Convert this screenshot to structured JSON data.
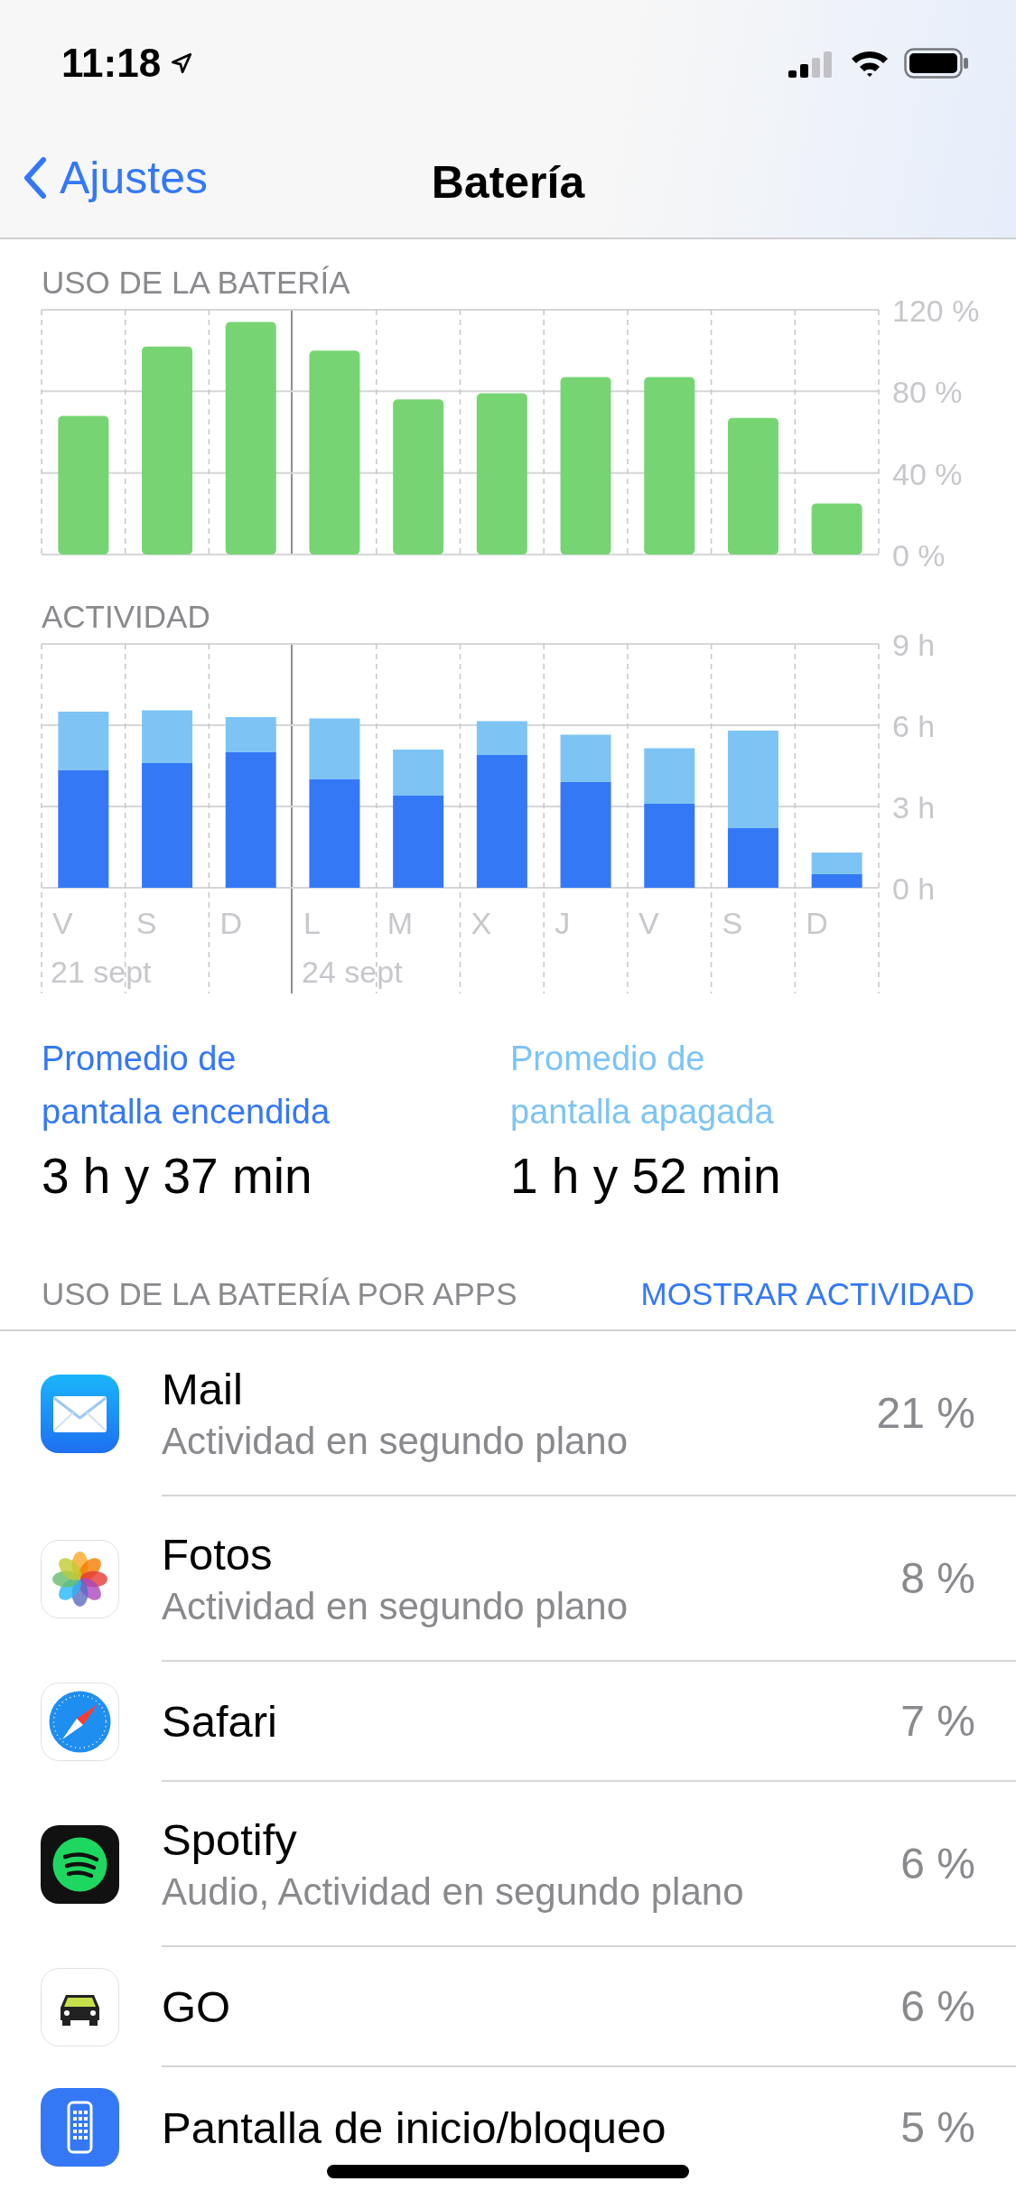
{
  "status_bar": {
    "time": "11:18"
  },
  "nav": {
    "back": "Ajustes",
    "title": "Batería"
  },
  "battery_usage": {
    "title": "USO DE LA BATERÍA",
    "chart_data": {
      "type": "bar",
      "ylim": [
        0,
        120
      ],
      "yticks": [
        {
          "value": 0,
          "label": "0 %"
        },
        {
          "value": 40,
          "label": "40 %"
        },
        {
          "value": 80,
          "label": "80 %"
        },
        {
          "value": 120,
          "label": "120 %"
        }
      ],
      "values": [
        68,
        102,
        114,
        100,
        76,
        79,
        87,
        87,
        67,
        25
      ]
    }
  },
  "activity": {
    "title": "ACTIVIDAD",
    "week_labels": [
      "21 sept",
      "24 sept"
    ],
    "chart_data": {
      "type": "bar",
      "stacked": true,
      "categories": [
        "V",
        "S",
        "D",
        "L",
        "M",
        "X",
        "J",
        "V",
        "S",
        "D"
      ],
      "ylim": [
        0,
        9
      ],
      "yticks": [
        {
          "value": 0,
          "label": "0 h"
        },
        {
          "value": 3,
          "label": "3 h"
        },
        {
          "value": 6,
          "label": "6 h"
        },
        {
          "value": 9,
          "label": "9 h"
        }
      ],
      "series": [
        {
          "color": "#3478f6",
          "values": [
            4.35,
            4.6,
            5.0,
            4.0,
            3.4,
            4.9,
            3.9,
            3.1,
            2.2,
            0.5
          ]
        },
        {
          "color": "#7dc4f5",
          "values": [
            2.15,
            1.95,
            1.3,
            2.25,
            1.7,
            1.25,
            1.75,
            2.05,
            3.6,
            0.8
          ]
        }
      ]
    }
  },
  "averages": [
    {
      "label": [
        "Promedio de",
        "pantalla encendida"
      ],
      "value": "3 h y 37 min",
      "color": "#3478f6"
    },
    {
      "label": [
        "Promedio de",
        "pantalla apagada"
      ],
      "value": "1 h y 52 min",
      "color": "#7dc4f5"
    }
  ],
  "apps_section": {
    "title": "USO DE LA BATERÍA POR APPS",
    "action": "MOSTRAR ACTIVIDAD"
  },
  "apps": [
    {
      "kind": "mail",
      "name": "Mail",
      "detail": "Actividad en segundo plano",
      "percent": "21 %"
    },
    {
      "kind": "photos",
      "name": "Fotos",
      "detail": "Actividad en segundo plano",
      "percent": "8 %"
    },
    {
      "kind": "safari",
      "name": "Safari",
      "percent": "7 %"
    },
    {
      "kind": "spotify",
      "name": "Spotify",
      "detail": "Audio, Actividad en segundo plano",
      "percent": "6 %"
    },
    {
      "kind": "car",
      "name": "GO",
      "percent": "6 %"
    },
    {
      "kind": "homescreen",
      "name": "Pantalla de inicio/bloqueo",
      "percent": "5 %"
    }
  ]
}
